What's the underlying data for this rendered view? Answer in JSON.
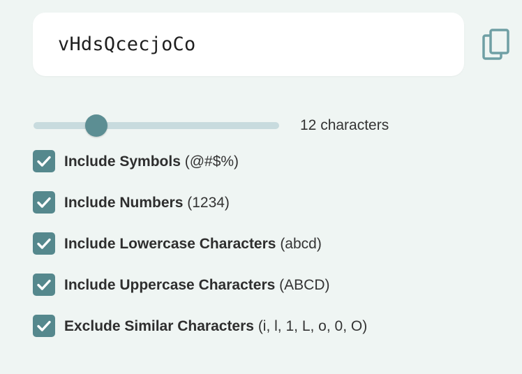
{
  "password": {
    "value": "vHdsQcecjoCo"
  },
  "copy_button": {
    "icon": "copy-icon"
  },
  "length": {
    "value": 12,
    "min": 6,
    "max": 32,
    "label": "12 characters"
  },
  "options": [
    {
      "label": "Include Symbols",
      "example": "(@#$%)",
      "checked": true
    },
    {
      "label": "Include Numbers",
      "example": "(1234)",
      "checked": true
    },
    {
      "label": "Include Lowercase Characters",
      "example": "(abcd)",
      "checked": true
    },
    {
      "label": "Include Uppercase Characters",
      "example": "(ABCD)",
      "checked": true
    },
    {
      "label": "Exclude Similar Characters",
      "example": "(i, l, 1, L, o, 0, O)",
      "checked": true
    }
  ],
  "colors": {
    "background": "#eff5f3",
    "accent": "#55888d",
    "track": "#c8dbde",
    "copy_icon": "#6f9fa4"
  }
}
